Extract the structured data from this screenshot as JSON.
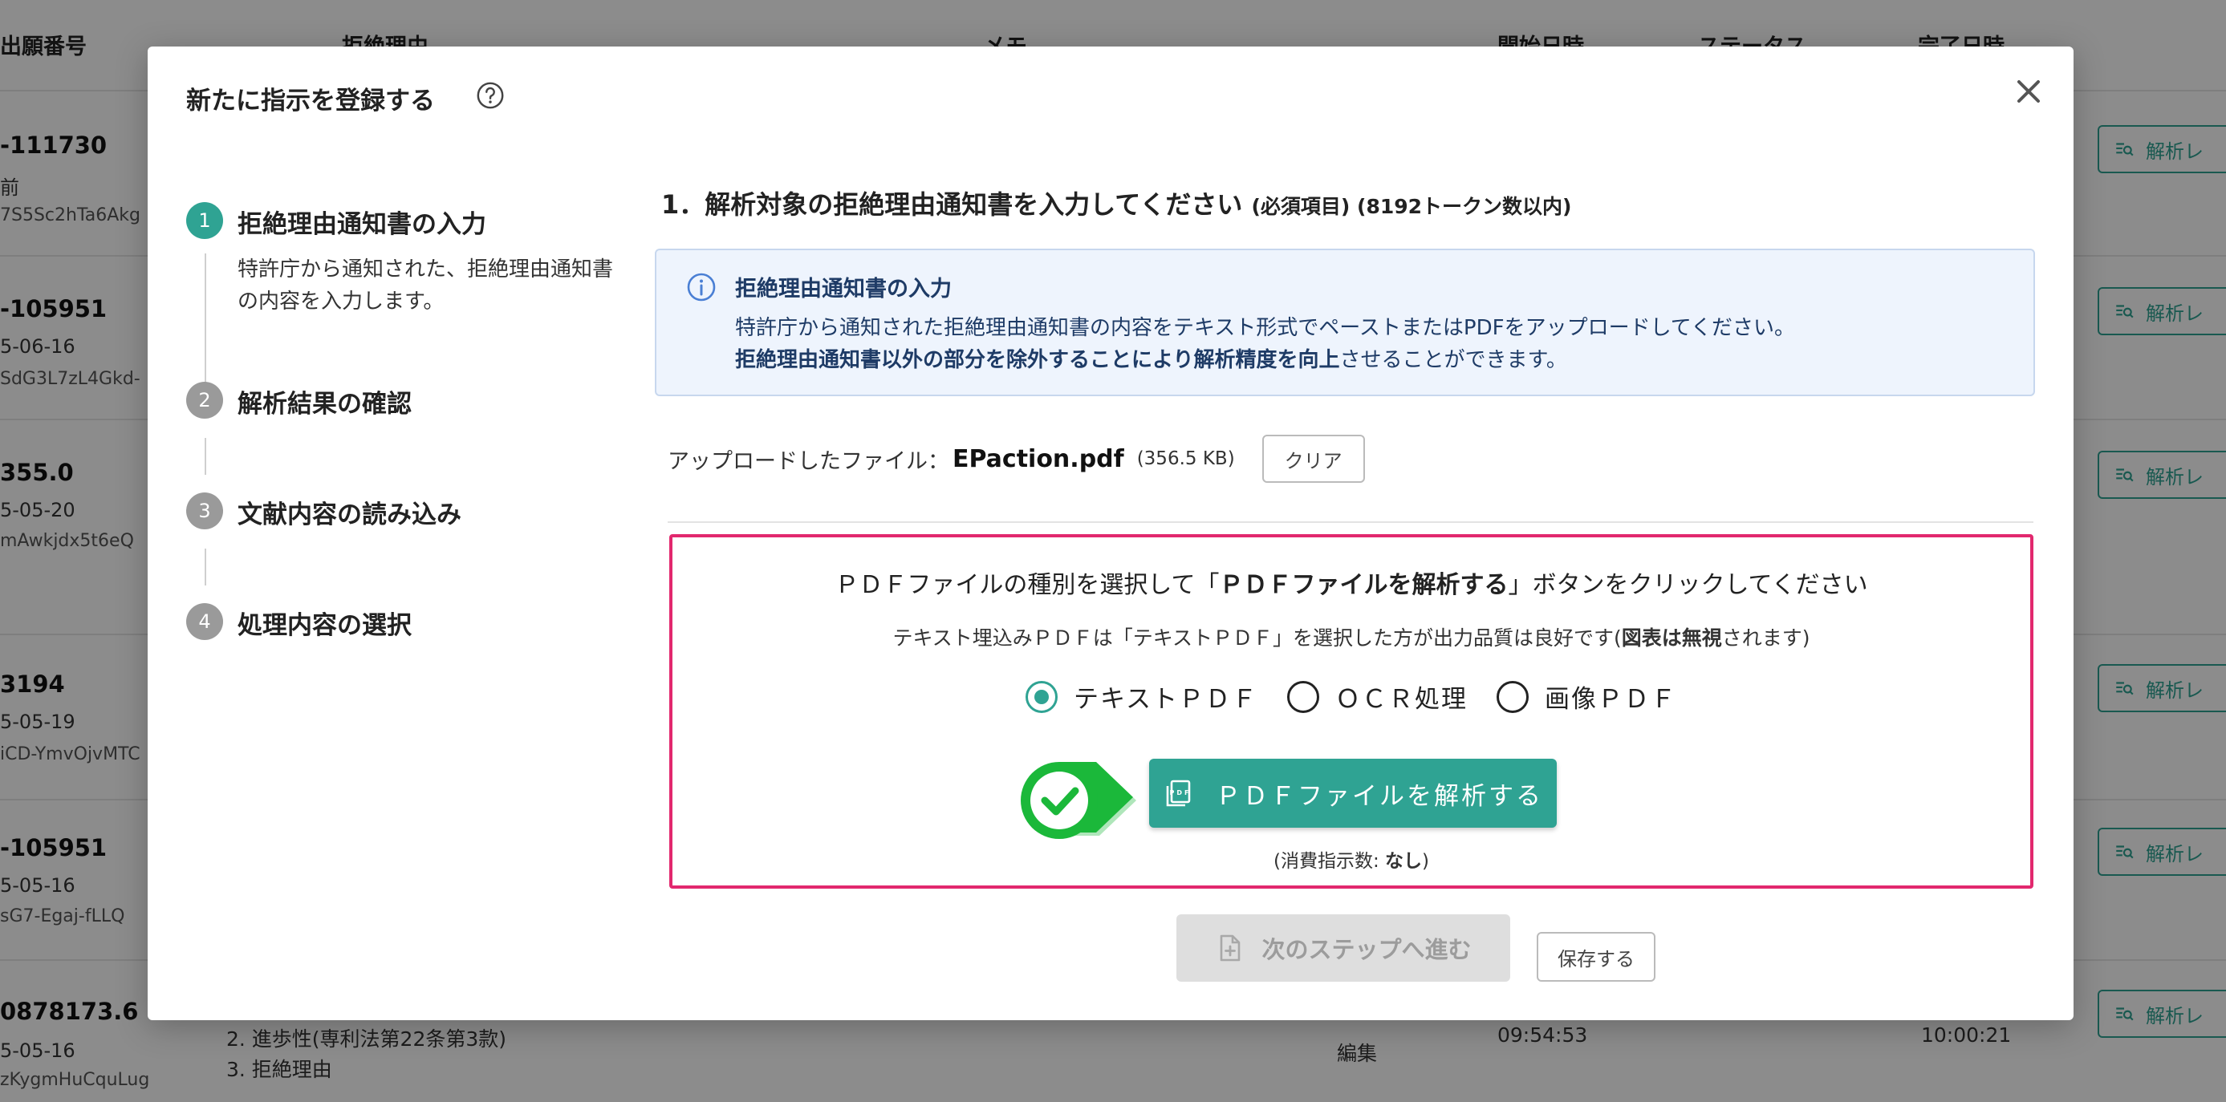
{
  "background_table": {
    "headers": [
      "出願番号",
      "拒絶理由",
      "メモ",
      "開始日時",
      "ステータス",
      "完了日時"
    ],
    "rows": [
      {
        "id": "-111730",
        "date": "前",
        "code": "7S5Sc2hTa6Akg"
      },
      {
        "id": "-105951",
        "date": "5-06-16",
        "code": "SdG3L7zL4Gkd-"
      },
      {
        "id": "355.0",
        "date": "5-05-20",
        "code": "mAwkjdx5t6eQ"
      },
      {
        "id": "3194",
        "date": "5-05-19",
        "code": "iCD-YmvOjvMTC"
      },
      {
        "id": "-105951",
        "date": "5-05-16",
        "code": "sG7-Egaj-fLLQ"
      },
      {
        "id": "0878173.6",
        "date": "5-05-16",
        "code": "zKygmHuCquLug"
      }
    ],
    "row_button_label": "解析レ",
    "last_row": {
      "reason_2": "2. 進歩性(専利法第22条第3款)",
      "reason_3": "3. 拒絶理由",
      "memo": "編集",
      "start_time": "09:54:53",
      "end_time": "10:00:21"
    }
  },
  "modal": {
    "title": "新たに指示を登録する",
    "steps": [
      {
        "number": "1",
        "label": "拒絶理由通知書の入力",
        "description": "特許庁から通知された、拒絶理由通知書の内容を入力します。",
        "active": true
      },
      {
        "number": "2",
        "label": "解析結果の確認",
        "active": false
      },
      {
        "number": "3",
        "label": "文献内容の読み込み",
        "active": false
      },
      {
        "number": "4",
        "label": "処理内容の選択",
        "active": false
      }
    ],
    "section_title": "1．解析対象の拒絶理由通知書を入力してください",
    "section_title_note": "(必須項目) (8192トークン数以内)",
    "info": {
      "title": "拒絶理由通知書の入力",
      "line1": "特許庁から通知された拒絶理由通知書の内容をテキスト形式でペーストまたはPDFをアップロードしてください。",
      "line2_bold": "拒絶理由通知書以外の部分を除外することにより解析精度を向上",
      "line2_rest": "させることができます。"
    },
    "upload": {
      "label": "アップロードしたファイル：",
      "filename": "EPaction.pdf",
      "size": "(356.5 KB)",
      "clear_label": "クリア"
    },
    "pdf_panel": {
      "instruction_pre": "ＰＤＦファイルの種別を選択して「",
      "instruction_bold": "ＰＤＦファイルを解析する",
      "instruction_post": "」ボタンをクリックしてください",
      "note_pre": "テキスト埋込みＰＤＦは「テキストＰＤＦ」を選択した方が出力品質は良好です(",
      "note_bold": "図表は無視",
      "note_post": "されます)",
      "options": [
        {
          "label": "テキストＰＤＦ",
          "checked": true
        },
        {
          "label": "ＯＣＲ処理",
          "checked": false
        },
        {
          "label": "画像ＰＤＦ",
          "checked": false
        }
      ],
      "analyze_label": "ＰＤＦファイルを解析する",
      "consume_pre": "(消費指示数: ",
      "consume_value": "なし",
      "consume_post": ")"
    },
    "next_label": "次のステップへ進む",
    "save_label": "保存する"
  },
  "colors": {
    "accent": "#2fa393",
    "highlight_border": "#e2286e",
    "info_bg": "#eef4fd",
    "check_green": "#1bb83a"
  },
  "icons": [
    "help-circle-icon",
    "close-icon",
    "info-icon",
    "pdf-file-icon",
    "check-badge-icon",
    "file-plus-icon",
    "search-list-icon"
  ]
}
